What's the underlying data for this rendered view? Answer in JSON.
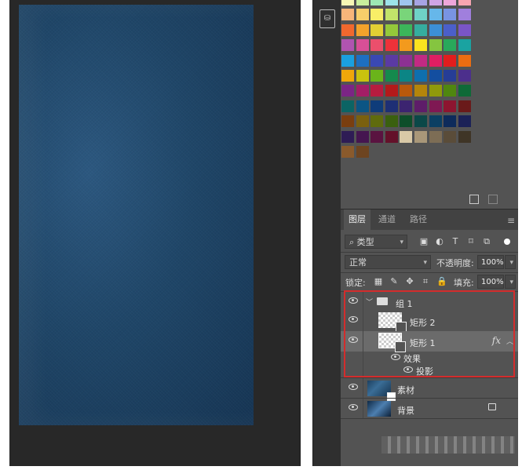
{
  "panel_tabs": {
    "layers": "图层",
    "channels": "通道",
    "paths": "路径"
  },
  "filter": {
    "kind": "类型"
  },
  "blend": {
    "mode": "正常",
    "opacity_label": "不透明度:",
    "opacity_value": "100%"
  },
  "lock": {
    "label": "锁定:",
    "fill_label": "填充:",
    "fill_value": "100%"
  },
  "layers": {
    "group": "组 1",
    "rect2": "矩形 2",
    "rect1": "矩形 1",
    "fx": "fx",
    "effects": "效果",
    "drop_shadow": "投影",
    "material": "素材",
    "background": "背景"
  },
  "colors": {
    "highlight_box": "#d42c2c",
    "canvas_blue": "#1f4668",
    "panel_bg": "#535353"
  },
  "swatches": [
    [
      "#f7f7b5",
      "#c9ef9d",
      "#9de8b4",
      "#9ce3ea",
      "#9fc5f0",
      "#a7a3e4",
      "#d0a4e5",
      "#eea6d9",
      "#f7a5b0"
    ],
    [
      "#f8b57a",
      "#f7ce6a",
      "#f8ee67",
      "#c2e46a",
      "#79d57a",
      "#6fd2c7",
      "#66b7ea",
      "#7994e3",
      "#a07fdd"
    ],
    [
      "#f0682e",
      "#f2a22b",
      "#e2cf34",
      "#94c83a",
      "#3cb55a",
      "#35ad9f",
      "#3c8fd6",
      "#4b5fc9",
      "#7a55c6"
    ],
    [
      "#b054b0",
      "#d84f97",
      "#eb4f6c",
      "#ee3239",
      "#f39a1d",
      "#fae31f",
      "#85c540",
      "#29a85b",
      "#1aa3a1"
    ],
    [
      "#1aa0e0",
      "#1d6fc1",
      "#3a48b3",
      "#5b3aa3",
      "#8d3193",
      "#c22a83",
      "#e01e62",
      "#e21d1d",
      "#eb6d11"
    ],
    [
      "#f0a70a",
      "#c9c20e",
      "#6ab41a",
      "#148a4d",
      "#0b8585",
      "#0e6fae",
      "#134ea0",
      "#263d96",
      "#4c2f8c"
    ],
    [
      "#7b2585",
      "#a31e66",
      "#b71c3f",
      "#b31a1a",
      "#b8590c",
      "#b4850a",
      "#8f9a0b",
      "#4f870f",
      "#0e6a37"
    ],
    [
      "#0b6464",
      "#0b5584",
      "#0f3c7a",
      "#1e2f75",
      "#3c2470",
      "#5e1d69",
      "#7f1853",
      "#8d1530",
      "#6a1a1a"
    ],
    [
      "#7a3e0f",
      "#7a600f",
      "#5f6b0d",
      "#3a600f",
      "#0d4e2a",
      "#0b4848",
      "#0b3f63",
      "#0e2b5b",
      "#1b2257"
    ],
    [
      "#2e1c55",
      "#451650",
      "#5a1340",
      "#64112a",
      "#d9c9a7",
      "#a99779",
      "#7d6d55",
      "#5a4c39",
      "#3f3526"
    ],
    [
      "#8a5a2c",
      "#6d4420"
    ]
  ]
}
